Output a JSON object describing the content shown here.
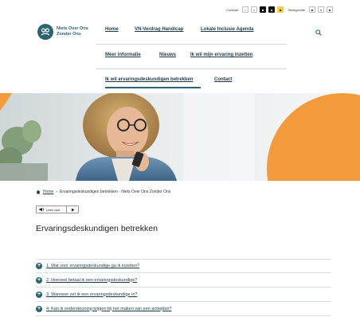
{
  "accessibility_bar": {
    "contrast_label": "Contrast",
    "font_size_label": "Tekstgrootte",
    "contrast_buttons": [
      "○",
      "◐",
      "■",
      "■",
      "■"
    ],
    "size_buttons": [
      "■",
      "A",
      "■"
    ]
  },
  "logo": {
    "line1": "Niets Over Ons",
    "line2": "Zonder Ons"
  },
  "nav": {
    "row1": [
      "Home",
      "VN-Verdrag Handicap",
      "Lokale Inclusie Agenda"
    ],
    "row2": [
      "Meer informatie",
      "Nieuws",
      "Ik wil mijn ervaring inzetten"
    ],
    "row3": [
      "Ik wil ervaringsdeskundigen betrekken",
      "Contact"
    ]
  },
  "breadcrumb": {
    "home": "Home",
    "separator": "›",
    "current": "Ervaringsdeskundigen betrekken - Niets Over Ons Zonder Ons"
  },
  "read_aloud": {
    "label": "Lees voor"
  },
  "page": {
    "heading": "Ervaringsdeskundigen betrekken"
  },
  "accordion": [
    "1. Wat voor ervaringsdeskundige ga ik inzetten?",
    "2. Hoeveel betaal ik een ervaringsdeskundige?",
    "3. Wanneer zet ik een ervaringsdeskundige in?",
    "4. Kan ik ondersteuning krijgen bij het maken van een actieplan?"
  ],
  "colors": {
    "brand": "#2a6470",
    "accent": "#f29a3c"
  }
}
